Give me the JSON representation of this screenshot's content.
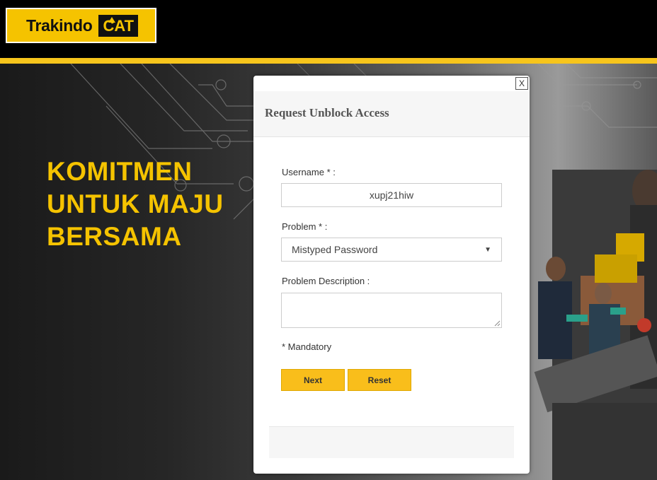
{
  "brand": {
    "name": "Trakindo",
    "mark": "CAT",
    "yellow": "#f5c300",
    "black": "#000000"
  },
  "hero": {
    "headline": [
      "KOMITMEN",
      "UNTUK MAJU",
      "BERSAMA"
    ]
  },
  "modal": {
    "close_label": "X",
    "title": "Request Unblock Access",
    "fields": {
      "username": {
        "label": "Username * :",
        "value": "xupj21hiw"
      },
      "problem": {
        "label": "Problem * :",
        "selected": "Mistyped Password"
      },
      "description": {
        "label": "Problem Description :",
        "value": ""
      }
    },
    "mandatory_note": "* Mandatory",
    "buttons": {
      "next": "Next",
      "reset": "Reset"
    },
    "button_color": "#f9be1b"
  }
}
